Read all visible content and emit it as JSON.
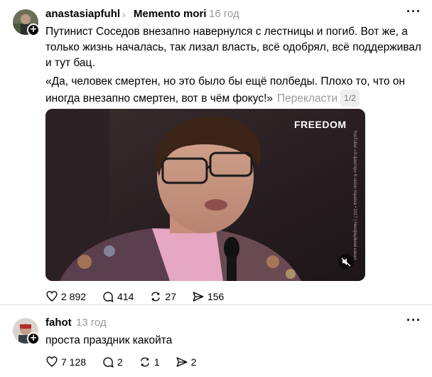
{
  "post": {
    "username": "anastasiapfuhl",
    "community": "Memento mori",
    "time": "16 год",
    "paragraph1": "Путинист Соседов внезапно навернулся с лестницы и погиб. Вот же, а только жизнь началась, так лизал власть, всё одобрял, всё поддерживал и тут бац.",
    "paragraph2": "«Да, человек смертен, но это было бы ещё полбеды. Плохо то, что он иногда внезапно смертен, вот в чём фокус!»",
    "translate_label": "Перекласти",
    "page_indicator": "1/2",
    "video": {
      "watermark": "FREEDOM",
      "side_caption": "YouTube/ «X-фактор» 8 сезон Україна • 2017 | Неофіційний канал"
    },
    "stats": {
      "likes": "2 892",
      "replies": "414",
      "reposts": "27",
      "shares": "156"
    }
  },
  "reply": {
    "username": "fahot",
    "time": "13 год",
    "text": "проста праздник какойта",
    "stats": {
      "likes": "7 128",
      "replies": "2",
      "reposts": "1",
      "shares": "2"
    }
  },
  "icons": [
    "more-icon",
    "heart-icon",
    "comment-icon",
    "repost-icon",
    "share-icon",
    "mute-icon",
    "follow-plus-icon"
  ],
  "colors": {
    "muted": "#9a9a9a",
    "divider": "#dedede",
    "text": "#000000"
  }
}
